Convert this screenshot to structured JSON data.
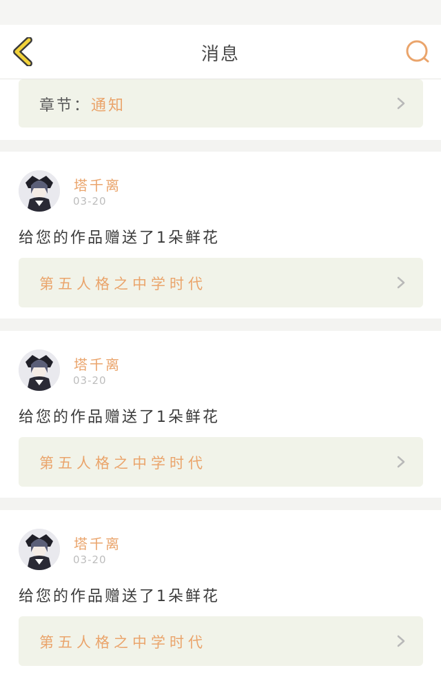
{
  "header": {
    "title": "消息",
    "back_icon": "chevron-left-icon",
    "search_icon": "search-icon"
  },
  "chapter": {
    "label": "章节：",
    "value": "通知"
  },
  "messages": [
    {
      "username": "塔千离",
      "date": "03-20",
      "text": "给您的作品赠送了1朵鲜花",
      "work_title": "第五人格之中学时代"
    },
    {
      "username": "塔千离",
      "date": "03-20",
      "text": "给您的作品赠送了1朵鲜花",
      "work_title": "第五人格之中学时代"
    },
    {
      "username": "塔千离",
      "date": "03-20",
      "text": "给您的作品赠送了1朵鲜花",
      "work_title": "第五人格之中学时代"
    }
  ],
  "colors": {
    "accent": "#eaa46b",
    "back_icon": "#f2d23a",
    "panel": "#f1f3e9"
  }
}
